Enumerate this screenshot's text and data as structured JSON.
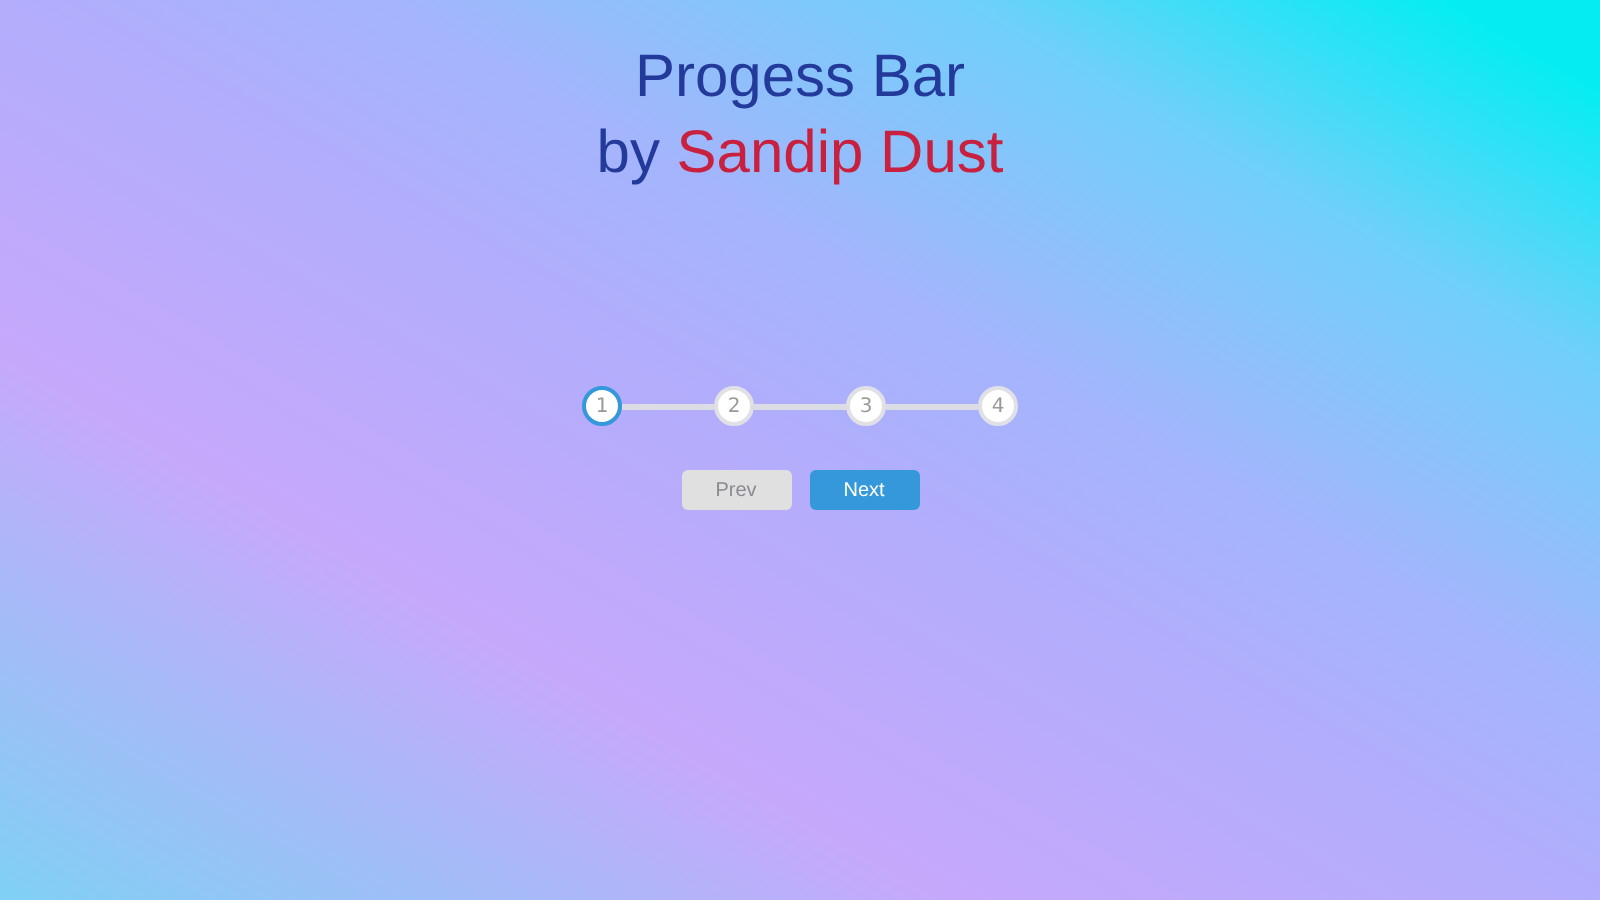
{
  "heading": {
    "line_1": "Progess Bar",
    "prefix": "by",
    "author": "Sandip Dust"
  },
  "steps": [
    {
      "label": "1",
      "active": true
    },
    {
      "label": "2",
      "active": false
    },
    {
      "label": "3",
      "active": false
    },
    {
      "label": "4",
      "active": false
    }
  ],
  "buttons": [
    {
      "label": "Prev",
      "disabled": true
    },
    {
      "label": "Next",
      "disabled": false
    }
  ]
}
